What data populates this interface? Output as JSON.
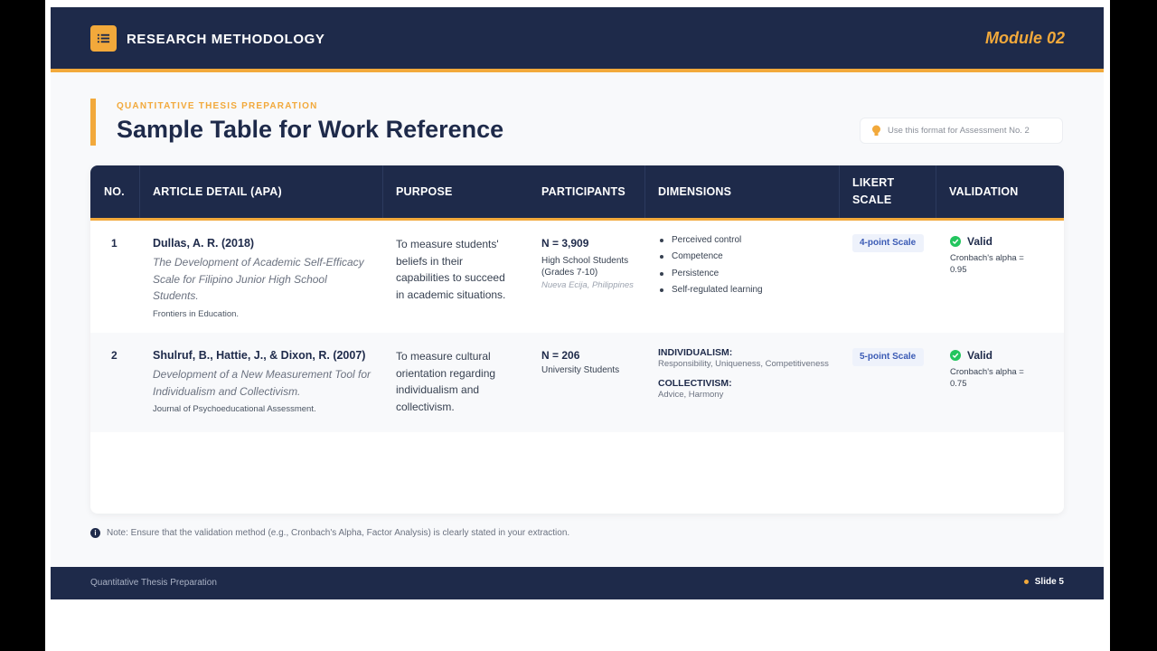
{
  "header": {
    "title": "RESEARCH METHODOLOGY",
    "module": "Module 02"
  },
  "intro": {
    "eyebrow": "QUANTITATIVE THESIS PREPARATION",
    "title": "Sample Table for Work Reference",
    "hint": "Use this format for Assessment No. 2"
  },
  "table": {
    "headers": [
      "NO.",
      "ARTICLE DETAIL (APA)",
      "PURPOSE",
      "PARTICIPANTS",
      "DIMENSIONS",
      "LIKERT SCALE",
      "VALIDATION"
    ],
    "rows": [
      {
        "no": "1",
        "author": "Dullas, A. R. (2018)",
        "article_title": "The Development of Academic Self-Efficacy Scale for Filipino Junior High School Students.",
        "journal": "Frontiers in Education.",
        "purpose": "To measure students' beliefs in their capabilities to succeed in academic situations.",
        "n": "N = 3,909",
        "participants": "High School Students (Grades 7-10)",
        "location": "Nueva Ecija, Philippines",
        "dimensions": [
          "Perceived control",
          "Competence",
          "Persistence",
          "Self-regulated learning"
        ],
        "likert": "4-point Scale",
        "validation": "Valid",
        "alpha": "Cronbach's alpha = 0.95"
      },
      {
        "no": "2",
        "author": "Shulruf, B., Hattie, J., & Dixon, R. (2007)",
        "article_title": "Development of a New Measurement Tool for Individualism and Collectivism.",
        "journal": "Journal of Psychoeducational Assessment.",
        "purpose": "To measure cultural orientation regarding individualism and collectivism.",
        "n": "N = 206",
        "participants": "University Students",
        "dim_group1_title": "INDIVIDUALISM:",
        "dim_group1_items": "Responsibility, Uniqueness, Competitiveness",
        "dim_group2_title": "COLLECTIVISM:",
        "dim_group2_items": "Advice, Harmony",
        "likert": "5-point Scale",
        "validation": "Valid",
        "alpha": "Cronbach's alpha = 0.75"
      }
    ]
  },
  "note": "Note: Ensure that the validation method (e.g., Cronbach's Alpha, Factor Analysis) is clearly stated in your extraction.",
  "footer": {
    "left": "Quantitative Thesis Preparation",
    "slide": "Slide 5"
  },
  "colors": {
    "navy": "#1e2a4a",
    "accent": "#f2a93b",
    "valid_green": "#22c55e",
    "likert_blue": "#3b5bb5"
  }
}
